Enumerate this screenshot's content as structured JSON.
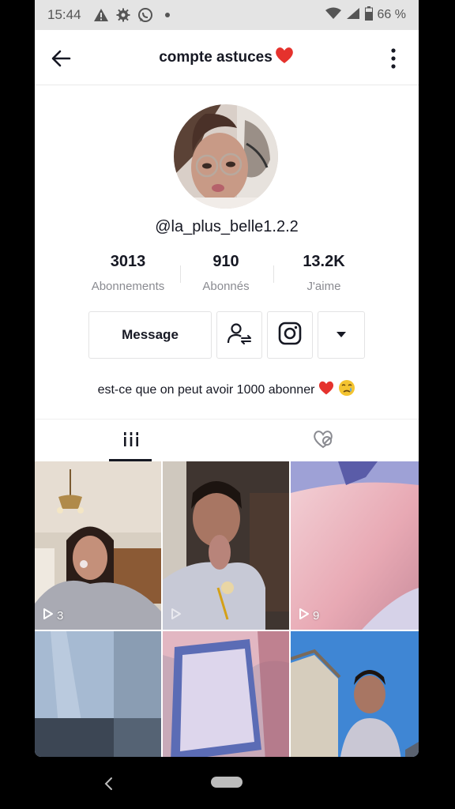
{
  "status_bar": {
    "time": "15:44",
    "battery": "66 %",
    "icons": [
      "alert-icon",
      "settings-icon",
      "whatsapp-icon",
      "dot-icon",
      "wifi-icon",
      "signal-icon",
      "battery-icon"
    ]
  },
  "header": {
    "title": "compte astuces",
    "title_emoji": "red-heart-icon"
  },
  "profile": {
    "username": "@la_plus_belle1.2.2",
    "stats": [
      {
        "value": "3013",
        "label": "Abonnements"
      },
      {
        "value": "910",
        "label": "Abonnés"
      },
      {
        "value": "13.2K",
        "label": "J'aime"
      }
    ],
    "message_label": "Message",
    "bio": "est-ce que on peut avoir 1000 abonner"
  },
  "tabs": [
    {
      "name": "videos",
      "icon": "grid-bars-icon",
      "active": true
    },
    {
      "name": "liked",
      "icon": "liked-heart-icon",
      "active": false
    }
  ],
  "videos": [
    {
      "plays": "3"
    },
    {
      "plays": ""
    },
    {
      "plays": "9"
    },
    {
      "plays": ""
    },
    {
      "plays": ""
    },
    {
      "plays": ""
    }
  ],
  "colors": {
    "text": "#161823",
    "secondary_text": "#8a8b91",
    "heart": "#e5322d",
    "border": "#e3e3e4"
  }
}
